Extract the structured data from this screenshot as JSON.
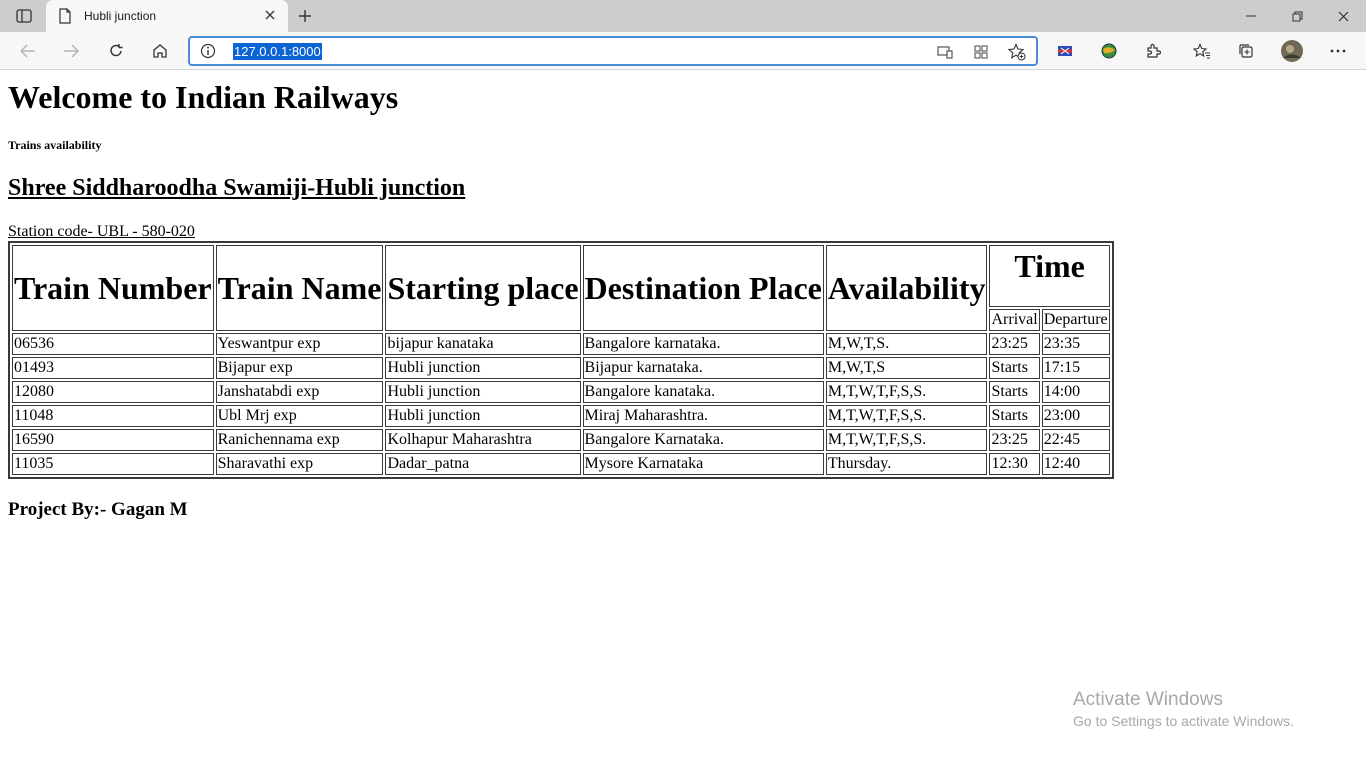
{
  "browser": {
    "tab_title": "Hubli junction",
    "address": "127.0.0.1:8000"
  },
  "page": {
    "heading": "Welcome to Indian Railways",
    "subtitle": "Trains availability",
    "station_title": "Shree Siddharoodha Swamiji-Hubli junction",
    "station_code": "Station code- UBL - 580-020",
    "table": {
      "headers": {
        "train_number": "Train Number",
        "train_name": "Train Name",
        "starting_place": "Starting place",
        "destination_place": "Destination Place",
        "availability": "Availability",
        "time": "Time",
        "arrival": "Arrival",
        "departure": "Departure"
      },
      "rows": [
        {
          "number": "06536",
          "name": "Yeswantpur exp",
          "start": "bijapur kanataka",
          "dest": "Bangalore karnataka.",
          "avail": "M,W,T,S.",
          "arr": "23:25",
          "dep": "23:35"
        },
        {
          "number": "01493",
          "name": "Bijapur exp",
          "start": "Hubli junction",
          "dest": "Bijapur karnataka.",
          "avail": "M,W,T,S",
          "arr": "Starts",
          "dep": "17:15"
        },
        {
          "number": "12080",
          "name": "Janshatabdi exp",
          "start": "Hubli junction",
          "dest": "Bangalore kanataka.",
          "avail": "M,T,W,T,F,S,S.",
          "arr": "Starts",
          "dep": "14:00"
        },
        {
          "number": "11048",
          "name": "Ubl Mrj exp",
          "start": "Hubli junction",
          "dest": "Miraj Maharashtra.",
          "avail": "M,T,W,T,F,S,S.",
          "arr": "Starts",
          "dep": "23:00"
        },
        {
          "number": "16590",
          "name": "Ranichennama exp",
          "start": "Kolhapur Maharashtra",
          "dest": "Bangalore Karnataka.",
          "avail": "M,T,W,T,F,S,S.",
          "arr": "23:25",
          "dep": "22:45"
        },
        {
          "number": "11035",
          "name": "Sharavathi exp",
          "start": "Dadar_patna",
          "dest": "Mysore Karnataka",
          "avail": "Thursday.",
          "arr": "12:30",
          "dep": "12:40"
        }
      ]
    },
    "footer": "Project By:- Gagan M"
  },
  "watermark": {
    "line1": "Activate Windows",
    "line2": "Go to Settings to activate Windows."
  }
}
